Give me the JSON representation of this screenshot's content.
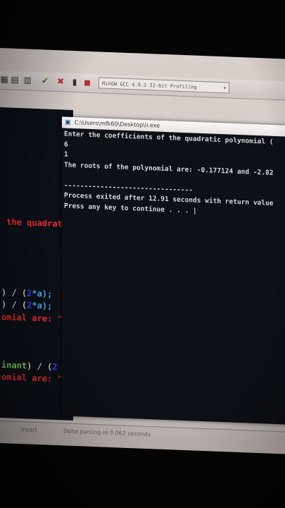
{
  "toolbar": {
    "compiler": "MinGW GCC 4.9.2 32-bit Profiling"
  },
  "editor": {
    "lines": [
      {
        "segments": [
          {
            "text": " the quadrat",
            "color": "red"
          }
        ]
      },
      {
        "segments": [
          {
            "text": ") / (",
            "color": "white"
          },
          {
            "text": "2",
            "color": "blue"
          },
          {
            "text": "*a);",
            "color": "cyan"
          }
        ]
      },
      {
        "segments": [
          {
            "text": ") / (",
            "color": "white"
          },
          {
            "text": "2",
            "color": "blue"
          },
          {
            "text": "*a);",
            "color": "cyan"
          }
        ]
      },
      {
        "segments": [
          {
            "text": "omial are: \"",
            "color": "red"
          }
        ]
      },
      {
        "segments": [
          {
            "text": "inant",
            "color": "green"
          },
          {
            "text": ") / (",
            "color": "white"
          },
          {
            "text": "2",
            "color": "blue"
          },
          {
            "text": " *",
            "color": "white"
          }
        ]
      },
      {
        "segments": [
          {
            "text": "omial are: \"",
            "color": "red"
          }
        ]
      }
    ]
  },
  "console": {
    "title": "C:\\Users\\mfk60\\Desktop\\ii.exe",
    "lines": [
      "Enter the coefficients of the quadratic polynomial (",
      "6",
      "1",
      "The roots of the polynomial are: -0.177124 and -2.82",
      "",
      "--------------------------------",
      "Process exited after 12.91 seconds with return value",
      "Press any key to continue . . . |"
    ]
  },
  "status": {
    "mode": "Insert",
    "message": "Done parsing in 0.062 seconds"
  }
}
